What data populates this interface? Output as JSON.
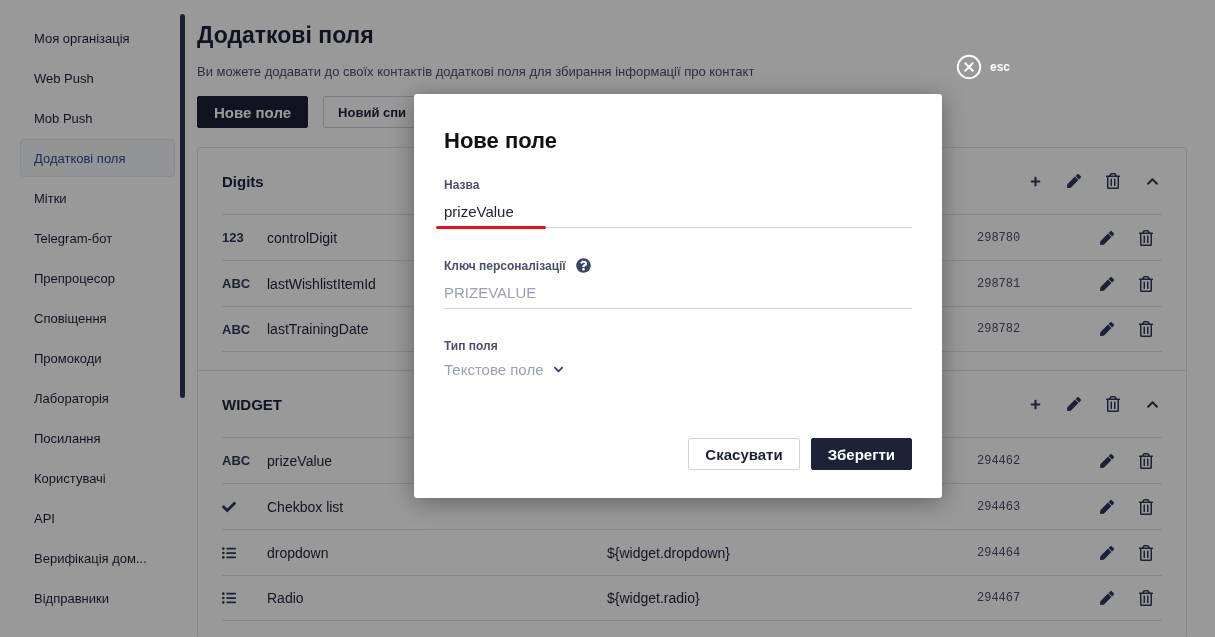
{
  "sidebar": {
    "items": [
      {
        "label": "Моя організація",
        "selected": false
      },
      {
        "label": "Web Push",
        "selected": false
      },
      {
        "label": "Mob Push",
        "selected": false
      },
      {
        "label": "Додаткові поля",
        "selected": true
      },
      {
        "label": "Мітки",
        "selected": false
      },
      {
        "label": "Telegram-бот",
        "selected": false
      },
      {
        "label": "Препроцесор",
        "selected": false
      },
      {
        "label": "Сповіщення",
        "selected": false
      },
      {
        "label": "Промокоди",
        "selected": false
      },
      {
        "label": "Лабораторія",
        "selected": false
      },
      {
        "label": "Посилання",
        "selected": false
      },
      {
        "label": "Користувачі",
        "selected": false
      },
      {
        "label": "API",
        "selected": false
      },
      {
        "label": "Верифікація дом...",
        "selected": false
      },
      {
        "label": "Відправники",
        "selected": false
      }
    ]
  },
  "page": {
    "title": "Додаткові поля",
    "subtitle": "Ви можете додавати до своїх контактів додаткові поля для збирання інформації про контакт"
  },
  "actions": [
    {
      "label": "Нове поле",
      "kind": "primary"
    },
    {
      "label": "Новий спи",
      "kind": "secondary"
    }
  ],
  "groups": [
    {
      "name": "Digits",
      "expanded": true,
      "rows": [
        {
          "kind": "number",
          "type_label": "123",
          "name": "controlDigit",
          "id": "298780"
        },
        {
          "kind": "text",
          "type_label": "ABC",
          "name": "lastWishlistItemId",
          "id": "298781"
        },
        {
          "kind": "text",
          "type_label": "ABC",
          "name": "lastTrainingDate",
          "id": "298782"
        }
      ]
    },
    {
      "name": "WIDGET",
      "expanded": true,
      "rows": [
        {
          "kind": "text",
          "type_label": "ABC",
          "name": "prizeValue",
          "id": "294462"
        },
        {
          "kind": "checkbox",
          "name": "Chekbox list",
          "id": "294463"
        },
        {
          "kind": "list",
          "name": "dropdown",
          "key": "${widget.dropdown}",
          "id": "294464"
        },
        {
          "kind": "list",
          "name": "Radio",
          "key": "${widget.radio}",
          "id": "294467"
        }
      ]
    }
  ],
  "close": {
    "label": "esc"
  },
  "dialog": {
    "title": "Нове поле",
    "fields": [
      {
        "kind": "text",
        "label": "Назва",
        "value": "prizeValue",
        "highlighted": true
      },
      {
        "kind": "text",
        "label": "Ключ персоналізації",
        "placeholder": "PRIZEVALUE",
        "help": true
      },
      {
        "kind": "select",
        "label": "Тип поля",
        "value": "Текстове поле"
      }
    ],
    "buttons": [
      {
        "label": "Скасувати",
        "kind": "secondary"
      },
      {
        "label": "Зберегти",
        "kind": "primary"
      }
    ]
  }
}
